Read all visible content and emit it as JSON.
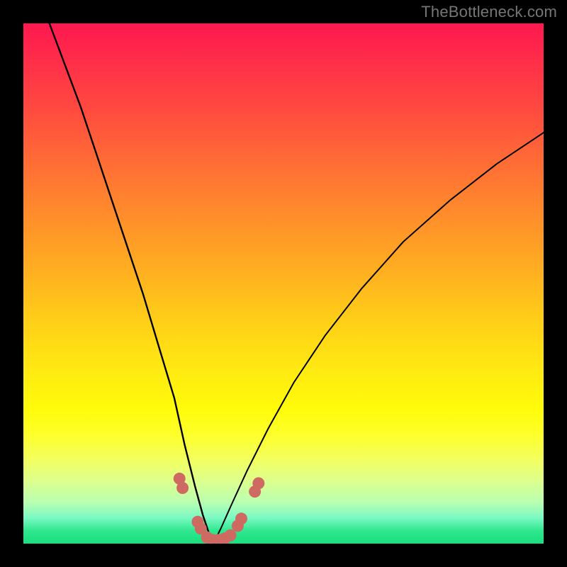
{
  "watermark": "TheBottleneck.com",
  "colors": {
    "background": "#000000",
    "curve": "#000000",
    "mark": "#cf6a62",
    "gradient_top": "#ff1850",
    "gradient_bottom": "#18df7e"
  },
  "chart_data": {
    "type": "line",
    "title": "",
    "xlabel": "",
    "ylabel": "",
    "xlim": [
      0,
      100
    ],
    "ylim": [
      0,
      100
    ],
    "note": "Two curves forming a V; y≈100 is top (red), y≈0 is bottom (green). No numeric axis labels are shown; values are estimated from pixel position.",
    "series": [
      {
        "name": "left-curve",
        "x": [
          5,
          8,
          11,
          14,
          17,
          20,
          23,
          26,
          29,
          31,
          33,
          34.5,
          35.5,
          36,
          36.4
        ],
        "y": [
          100,
          92,
          84,
          75,
          66,
          57,
          48,
          38,
          28,
          19,
          11,
          5.5,
          2.5,
          1,
          0.5
        ]
      },
      {
        "name": "right-curve",
        "x": [
          36.4,
          37,
          38,
          40,
          43,
          47,
          52,
          58,
          65,
          73,
          82,
          91,
          100
        ],
        "y": [
          0.5,
          1,
          3,
          7.5,
          14,
          22,
          31,
          40,
          49,
          58,
          66,
          73,
          79
        ]
      }
    ],
    "marks": {
      "name": "highlighted-points",
      "color_hint": "#cf6a62",
      "points": [
        {
          "x": 30.0,
          "y": 12.5
        },
        {
          "x": 30.6,
          "y": 10.7
        },
        {
          "x": 33.5,
          "y": 4.2
        },
        {
          "x": 34.1,
          "y": 2.9
        },
        {
          "x": 35.3,
          "y": 1.2
        },
        {
          "x": 36.4,
          "y": 0.7
        },
        {
          "x": 37.5,
          "y": 0.7
        },
        {
          "x": 38.7,
          "y": 1.0
        },
        {
          "x": 39.8,
          "y": 1.6
        },
        {
          "x": 41.2,
          "y": 3.4
        },
        {
          "x": 41.9,
          "y": 4.8
        },
        {
          "x": 44.5,
          "y": 10.0
        },
        {
          "x": 45.2,
          "y": 11.6
        }
      ]
    }
  }
}
